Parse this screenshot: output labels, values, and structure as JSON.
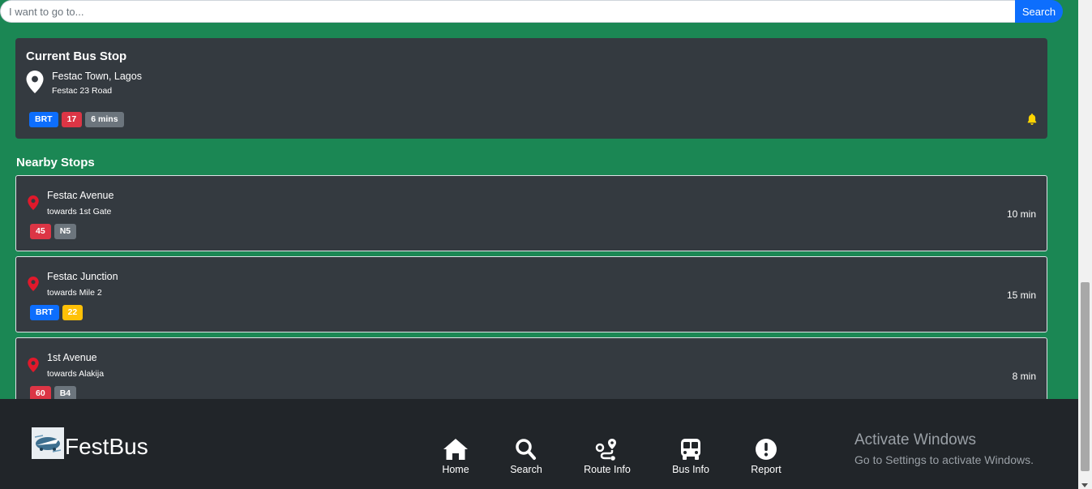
{
  "search": {
    "placeholder": "I want to go to...",
    "button_label": "Search"
  },
  "current_stop": {
    "title": "Current Bus Stop",
    "name": "Festac Town, Lagos",
    "road": "Festac 23 Road",
    "badges": [
      "BRT",
      "17",
      "6 mins"
    ]
  },
  "nearby": {
    "title": "Nearby Stops",
    "stops": [
      {
        "name": "Festac Avenue",
        "direction": "towards 1st Gate",
        "badges": [
          "45",
          "N5"
        ],
        "time": "10 min"
      },
      {
        "name": "Festac Junction",
        "direction": "towards Mile 2",
        "badges": [
          "BRT",
          "22"
        ],
        "time": "15 min"
      },
      {
        "name": "1st Avenue",
        "direction": "towards Alakija",
        "badges": [
          "60",
          "B4"
        ],
        "time": "8 min"
      }
    ]
  },
  "footer": {
    "brand": "FestBus",
    "nav": [
      {
        "label": "Home",
        "icon": "home-icon"
      },
      {
        "label": "Search",
        "icon": "search-icon"
      },
      {
        "label": "Route Info",
        "icon": "route-icon"
      },
      {
        "label": "Bus Info",
        "icon": "bus-icon"
      },
      {
        "label": "Report",
        "icon": "alert-icon"
      }
    ]
  },
  "watermark": {
    "title": "Activate Windows",
    "subtitle": "Go to Settings to activate Windows."
  },
  "colors": {
    "background": "#1b8754",
    "card": "#343a40",
    "primary": "#0d6efd",
    "danger": "#dc3545",
    "secondary": "#6c757d",
    "warning": "#ffc107",
    "footer": "#212529"
  }
}
